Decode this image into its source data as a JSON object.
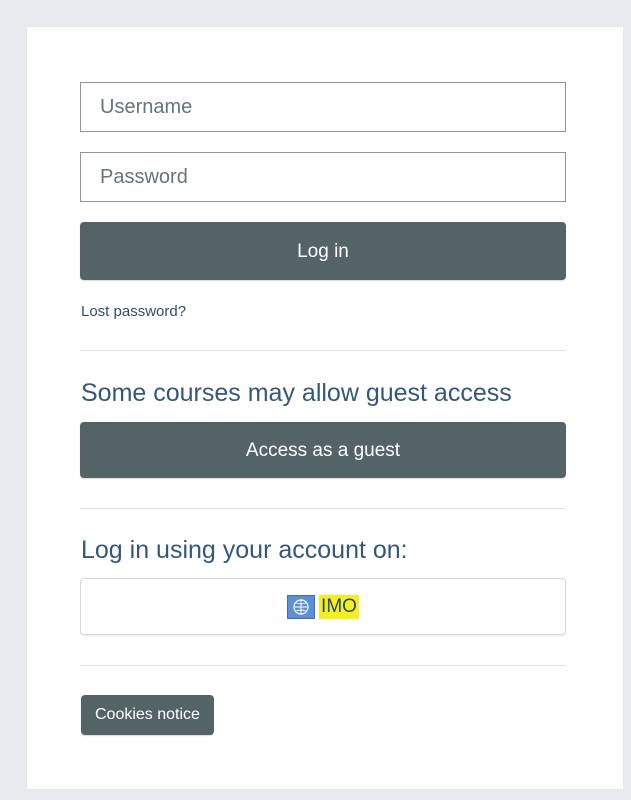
{
  "login": {
    "username_placeholder": "Username",
    "username_value": "",
    "password_placeholder": "Password",
    "password_value": "",
    "login_label": "Log in",
    "lost_password_label": "Lost password?"
  },
  "guest": {
    "heading": "Some courses may allow guest access",
    "button_label": "Access as a guest"
  },
  "identity_providers": {
    "heading": "Log in using your account on:",
    "items": [
      {
        "name": "IMO",
        "icon": "imo-logo-icon"
      }
    ]
  },
  "footer": {
    "cookies_label": "Cookies notice"
  },
  "colors": {
    "button_bg": "#546466",
    "heading_text": "#34577d",
    "link_text": "#2f4f70",
    "highlight": "#f5ef1b",
    "page_bg": "#e9ebee"
  }
}
